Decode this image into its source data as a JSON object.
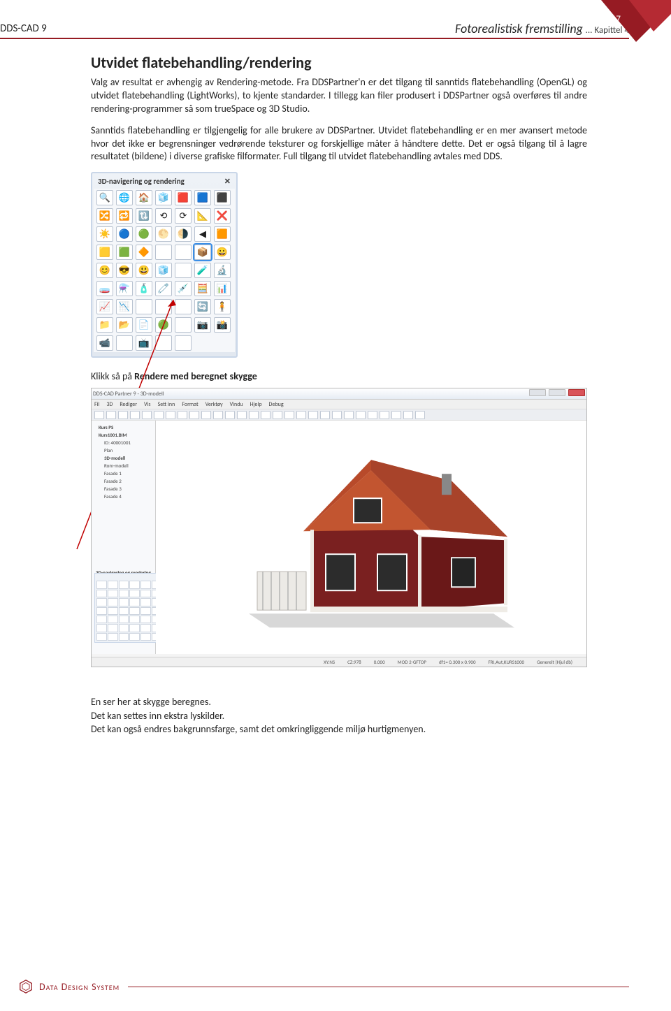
{
  "page_number": "7",
  "header": {
    "product": "DDS-CAD 9",
    "chapter_main": "Fotorealistisk fremstilling",
    "chapter_suffix": "... Kapittel 4"
  },
  "section_title": "Utvidet flatebehandling/rendering",
  "para1": "Valg av resultat er avhengig av Rendering-metode. Fra DDSPartner'n er det tilgang til sanntids flatebehandling (OpenGL) og utvidet flatebehandling (LightWorks), to kjente standarder. I tillegg kan filer produsert i DDSPartner også overføres til andre rendering-programmer så som trueSpace og 3D Studio.",
  "para2": "Sanntids flatebehandling er tilgjengelig for alle brukere av DDSPartner. Utvidet flatebehandling er en mer avansert metode hvor det ikke er begrensninger vedrørende teksturer og forskjellige måter å håndtere dette. Det er også tilgang til å lagre resultatet (bildene) i diverse grafiske filformater. Full tilgang til utvidet flatebehandling avtales med DDS.",
  "palette": {
    "title": "3D-navigering og rendering",
    "close": "✕",
    "icons": [
      "🔍",
      "🌐",
      "🏠",
      "🧊",
      "🟥",
      "🟦",
      "⬛",
      "🔀",
      "🔁",
      "🔃",
      "⟲",
      "⟳",
      "📐",
      "❌",
      "☀️",
      "🔵",
      "🟢",
      "🌕",
      "🌗",
      "◀",
      "🟧",
      "🟨",
      "🟩",
      "🔶",
      "",
      "",
      "📦",
      "😀",
      "😊",
      "😎",
      "😃",
      "🧊",
      "",
      "🧪",
      "🔬",
      "🧫",
      "⚗️",
      "🧴",
      "🧷",
      "💉",
      "🧮",
      "📊",
      "📈",
      "📉",
      "",
      "",
      "",
      "🔄",
      "🧍",
      "📁",
      "📂",
      "📄",
      "🟢",
      "",
      "📷",
      "📸",
      "📹",
      "",
      "📺",
      "",
      ""
    ],
    "selected_index": 26
  },
  "instruction_prefix": "Klikk så på ",
  "instruction_bold": "Rendere med beregnet skygge",
  "app": {
    "title": "DDS-CAD Partner 9 - 3D-modell",
    "menu": [
      "Fil",
      "3D",
      "Rediger",
      "Vis",
      "Sett inn",
      "Format",
      "Verktøy",
      "Vindu",
      "Hjelp",
      "Debug"
    ],
    "tree_root": "Kurs PS",
    "tree_proj": "Kurs1001.BIM",
    "tree_items": [
      "ID: 40001001",
      "Plan",
      "3D-modell",
      "Rom-modell",
      "Fasade 1",
      "Fasade 2",
      "Fasade 3",
      "Fasade 4"
    ],
    "mini_palette_title": "3D-navigering og rendering",
    "status": [
      "XY:NS",
      "CZ:978",
      "0.000",
      "MOD 2-GFTOP",
      "df1= 0.300 x 0.900",
      "FRI,Aut,KURS1000",
      "Generelt (Hjul db)"
    ]
  },
  "closing_lines": [
    "En ser her at skygge beregnes.",
    "Det kan settes inn ekstra lyskilder.",
    "Det kan også endres bakgrunnsfarge, samt det omkringliggende miljø hurtigmenyen."
  ],
  "footer": "Data Design System"
}
